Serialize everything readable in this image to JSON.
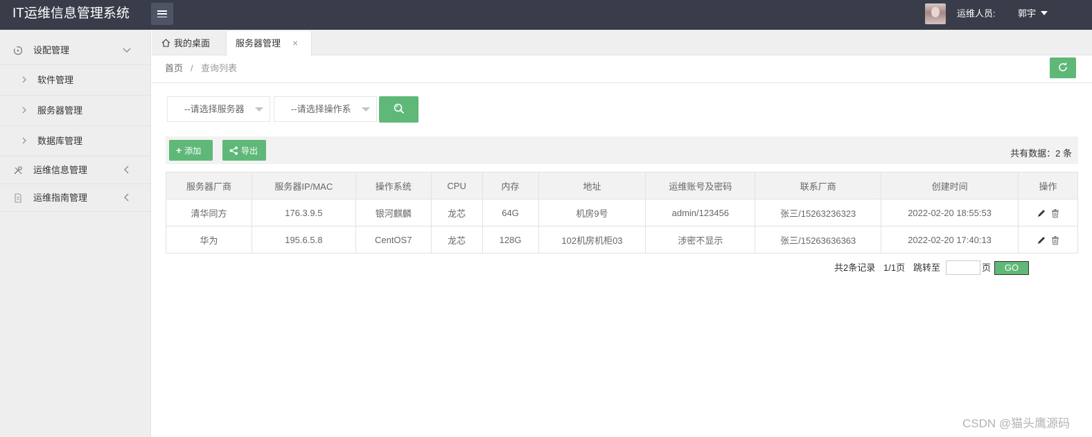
{
  "app": {
    "title": "IT运维信息管理系统"
  },
  "header": {
    "role_label": "运维人员:",
    "user_name": "郭宇"
  },
  "sidebar": {
    "groups": [
      {
        "label": "设配管理",
        "icon": "settings-circle-icon",
        "expanded": true,
        "items": [
          {
            "label": "软件管理"
          },
          {
            "label": "服务器管理"
          },
          {
            "label": "数据库管理"
          }
        ]
      },
      {
        "label": "运维信息管理",
        "icon": "tools-icon",
        "expanded": false
      },
      {
        "label": "运维指南管理",
        "icon": "document-icon",
        "expanded": false
      }
    ]
  },
  "tabs": [
    {
      "label": "我的桌面",
      "icon": "home-icon"
    },
    {
      "label": "服务器管理",
      "active": true,
      "close": "×"
    }
  ],
  "breadcrumb": {
    "home": "首页",
    "separator": "/",
    "current": "查询列表"
  },
  "filters": {
    "server_select": "--请选择服务器",
    "os_select": "--请选择操作系"
  },
  "toolbar": {
    "add_label": "添加",
    "add_icon": "+",
    "export_label": "导出",
    "count_text": "共有数据：2 条"
  },
  "table": {
    "headers": [
      "服务器厂商",
      "服务器IP/MAC",
      "操作系统",
      "CPU",
      "内存",
      "地址",
      "运维账号及密码",
      "联系厂商",
      "创建时间",
      "操作"
    ],
    "rows": [
      [
        "清华同方",
        "176.3.9.5",
        "银河麒麟",
        "龙芯",
        "64G",
        "机房9号",
        "admin/123456",
        "张三/15263236323",
        "2022-02-20 18:55:53"
      ],
      [
        "华为",
        "195.6.5.8",
        "CentOS7",
        "龙芯",
        "128G",
        "102机房机柜03",
        "涉密不显示",
        "张三/15263636363",
        "2022-02-20 17:40:13"
      ]
    ]
  },
  "pager": {
    "summary": "共2条记录",
    "pages": "1/1页",
    "jump_label": "跳转至",
    "page_unit": "页",
    "go_label": "GO",
    "input_value": ""
  },
  "watermark": "CSDN @猫头鹰源码",
  "colors": {
    "header_bg": "#393d49",
    "accent_green": "#5fb878",
    "sidebar_bg": "#eeeeee"
  }
}
